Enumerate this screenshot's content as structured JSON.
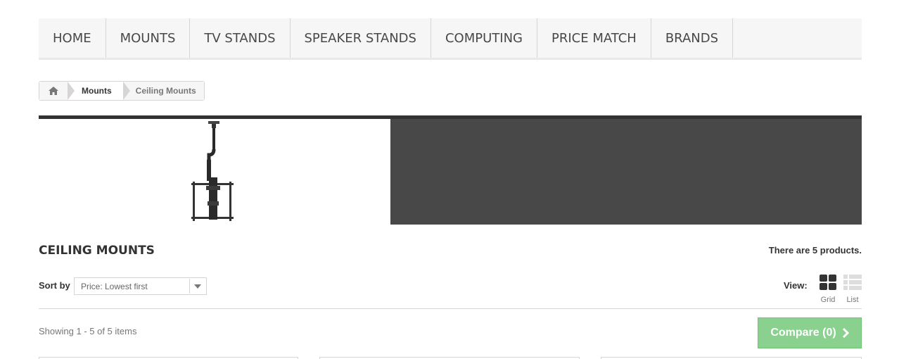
{
  "nav": {
    "items": [
      {
        "label": "HOME"
      },
      {
        "label": "MOUNTS"
      },
      {
        "label": "TV STANDS"
      },
      {
        "label": "SPEAKER STANDS"
      },
      {
        "label": "COMPUTING"
      },
      {
        "label": "PRICE MATCH"
      },
      {
        "label": "BRANDS"
      }
    ]
  },
  "breadcrumb": {
    "home_icon": "home-icon",
    "parent": "Mounts",
    "current": "Ceiling Mounts"
  },
  "category": {
    "title": "CEILING MOUNTS",
    "product_count_text": "There are 5 products."
  },
  "sort": {
    "label": "Sort by",
    "selected": "Price: Lowest first"
  },
  "view": {
    "label": "View:",
    "grid_label": "Grid",
    "list_label": "List",
    "active": "grid"
  },
  "listing": {
    "showing_text": "Showing 1 - 5 of 5 items",
    "compare_label": "Compare (0)"
  },
  "colors": {
    "accent_green": "#8ad08e",
    "banner_dark": "#484848"
  }
}
